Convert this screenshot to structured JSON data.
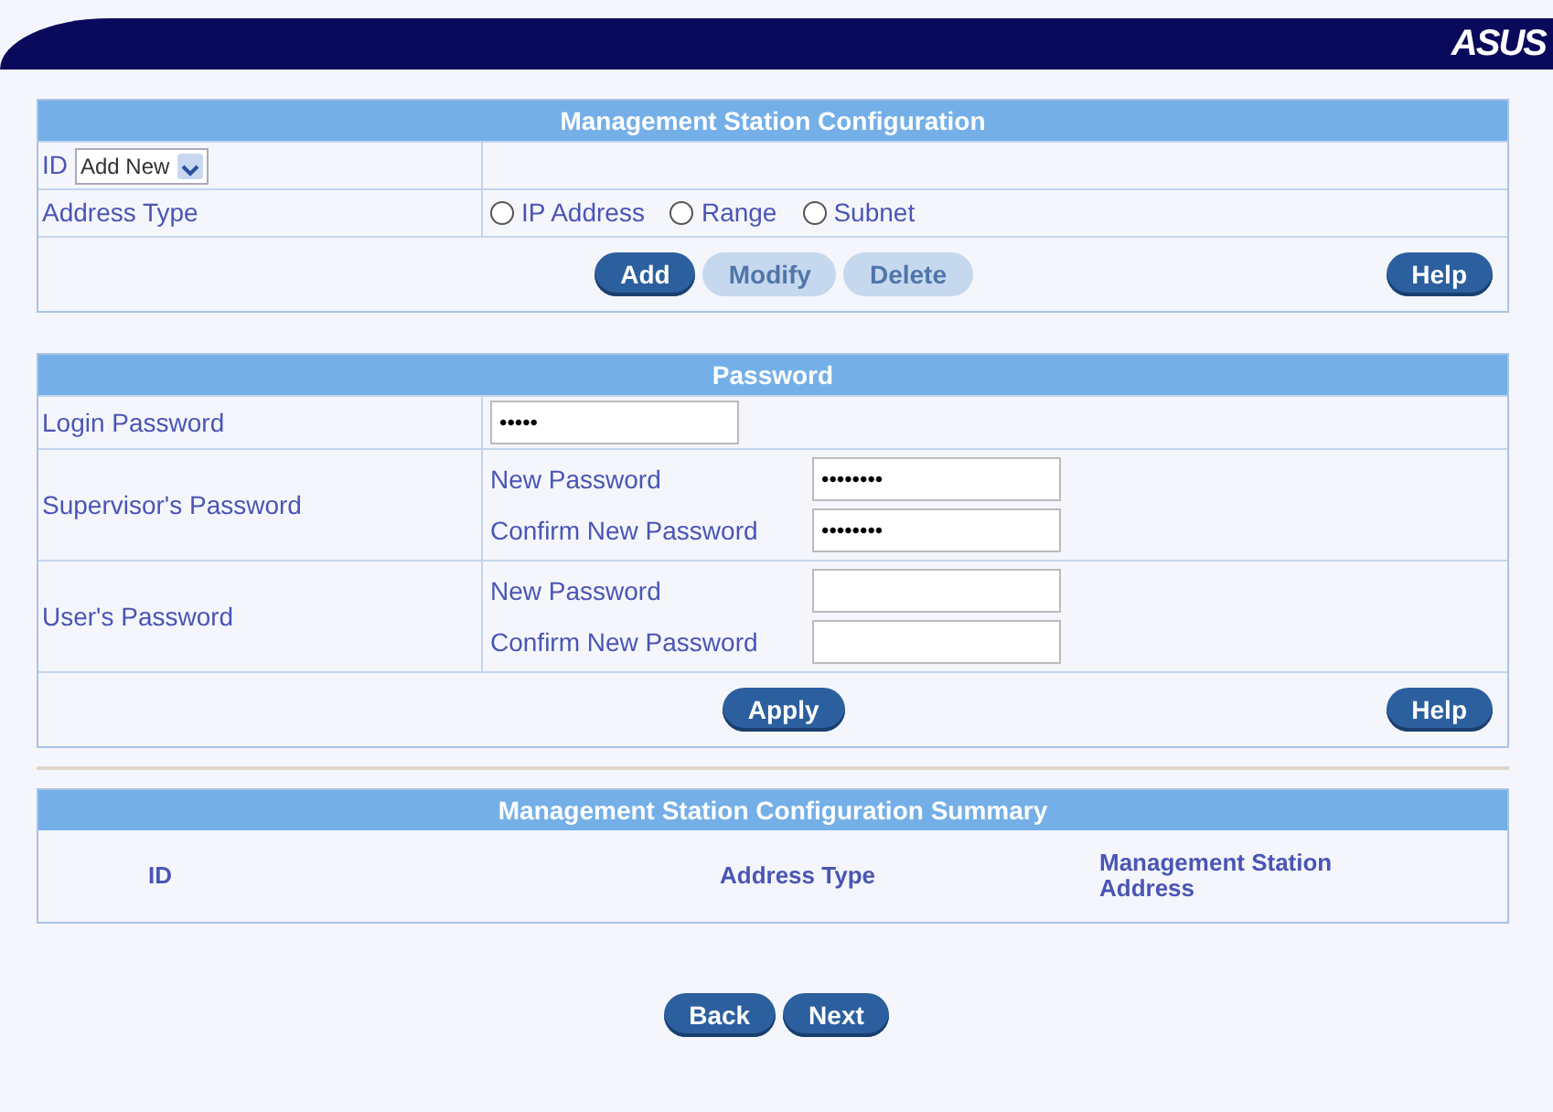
{
  "header": {
    "logo": "ASUS"
  },
  "station_config": {
    "title": "Management Station Configuration",
    "id_label": "ID",
    "id_select": "Add New",
    "address_type_label": "Address Type",
    "address_types": [
      {
        "label": "IP Address",
        "selected": false
      },
      {
        "label": "Range",
        "selected": false
      },
      {
        "label": "Subnet",
        "selected": false
      }
    ],
    "buttons": [
      {
        "label": "Add",
        "disabled": false
      },
      {
        "label": "Modify",
        "disabled": true
      },
      {
        "label": "Delete",
        "disabled": true
      }
    ],
    "help": "Help"
  },
  "password": {
    "title": "Password",
    "login_label": "Login Password",
    "login_value": "•••••",
    "groups": [
      {
        "label": "Supervisor's Password",
        "fields": [
          {
            "label": "New Password",
            "value": "••••••••"
          },
          {
            "label": "Confirm New Password",
            "value": "••••••••"
          }
        ]
      },
      {
        "label": "User's Password",
        "fields": [
          {
            "label": "New Password"
          },
          {
            "label": "Confirm New Password"
          }
        ]
      }
    ],
    "apply": "Apply",
    "help": "Help"
  },
  "summary": {
    "title": "Management Station Configuration Summary",
    "columns": [
      "ID",
      "Address Type",
      "Management Station Address"
    ]
  },
  "nav_buttons": [
    "Back",
    "Next"
  ]
}
